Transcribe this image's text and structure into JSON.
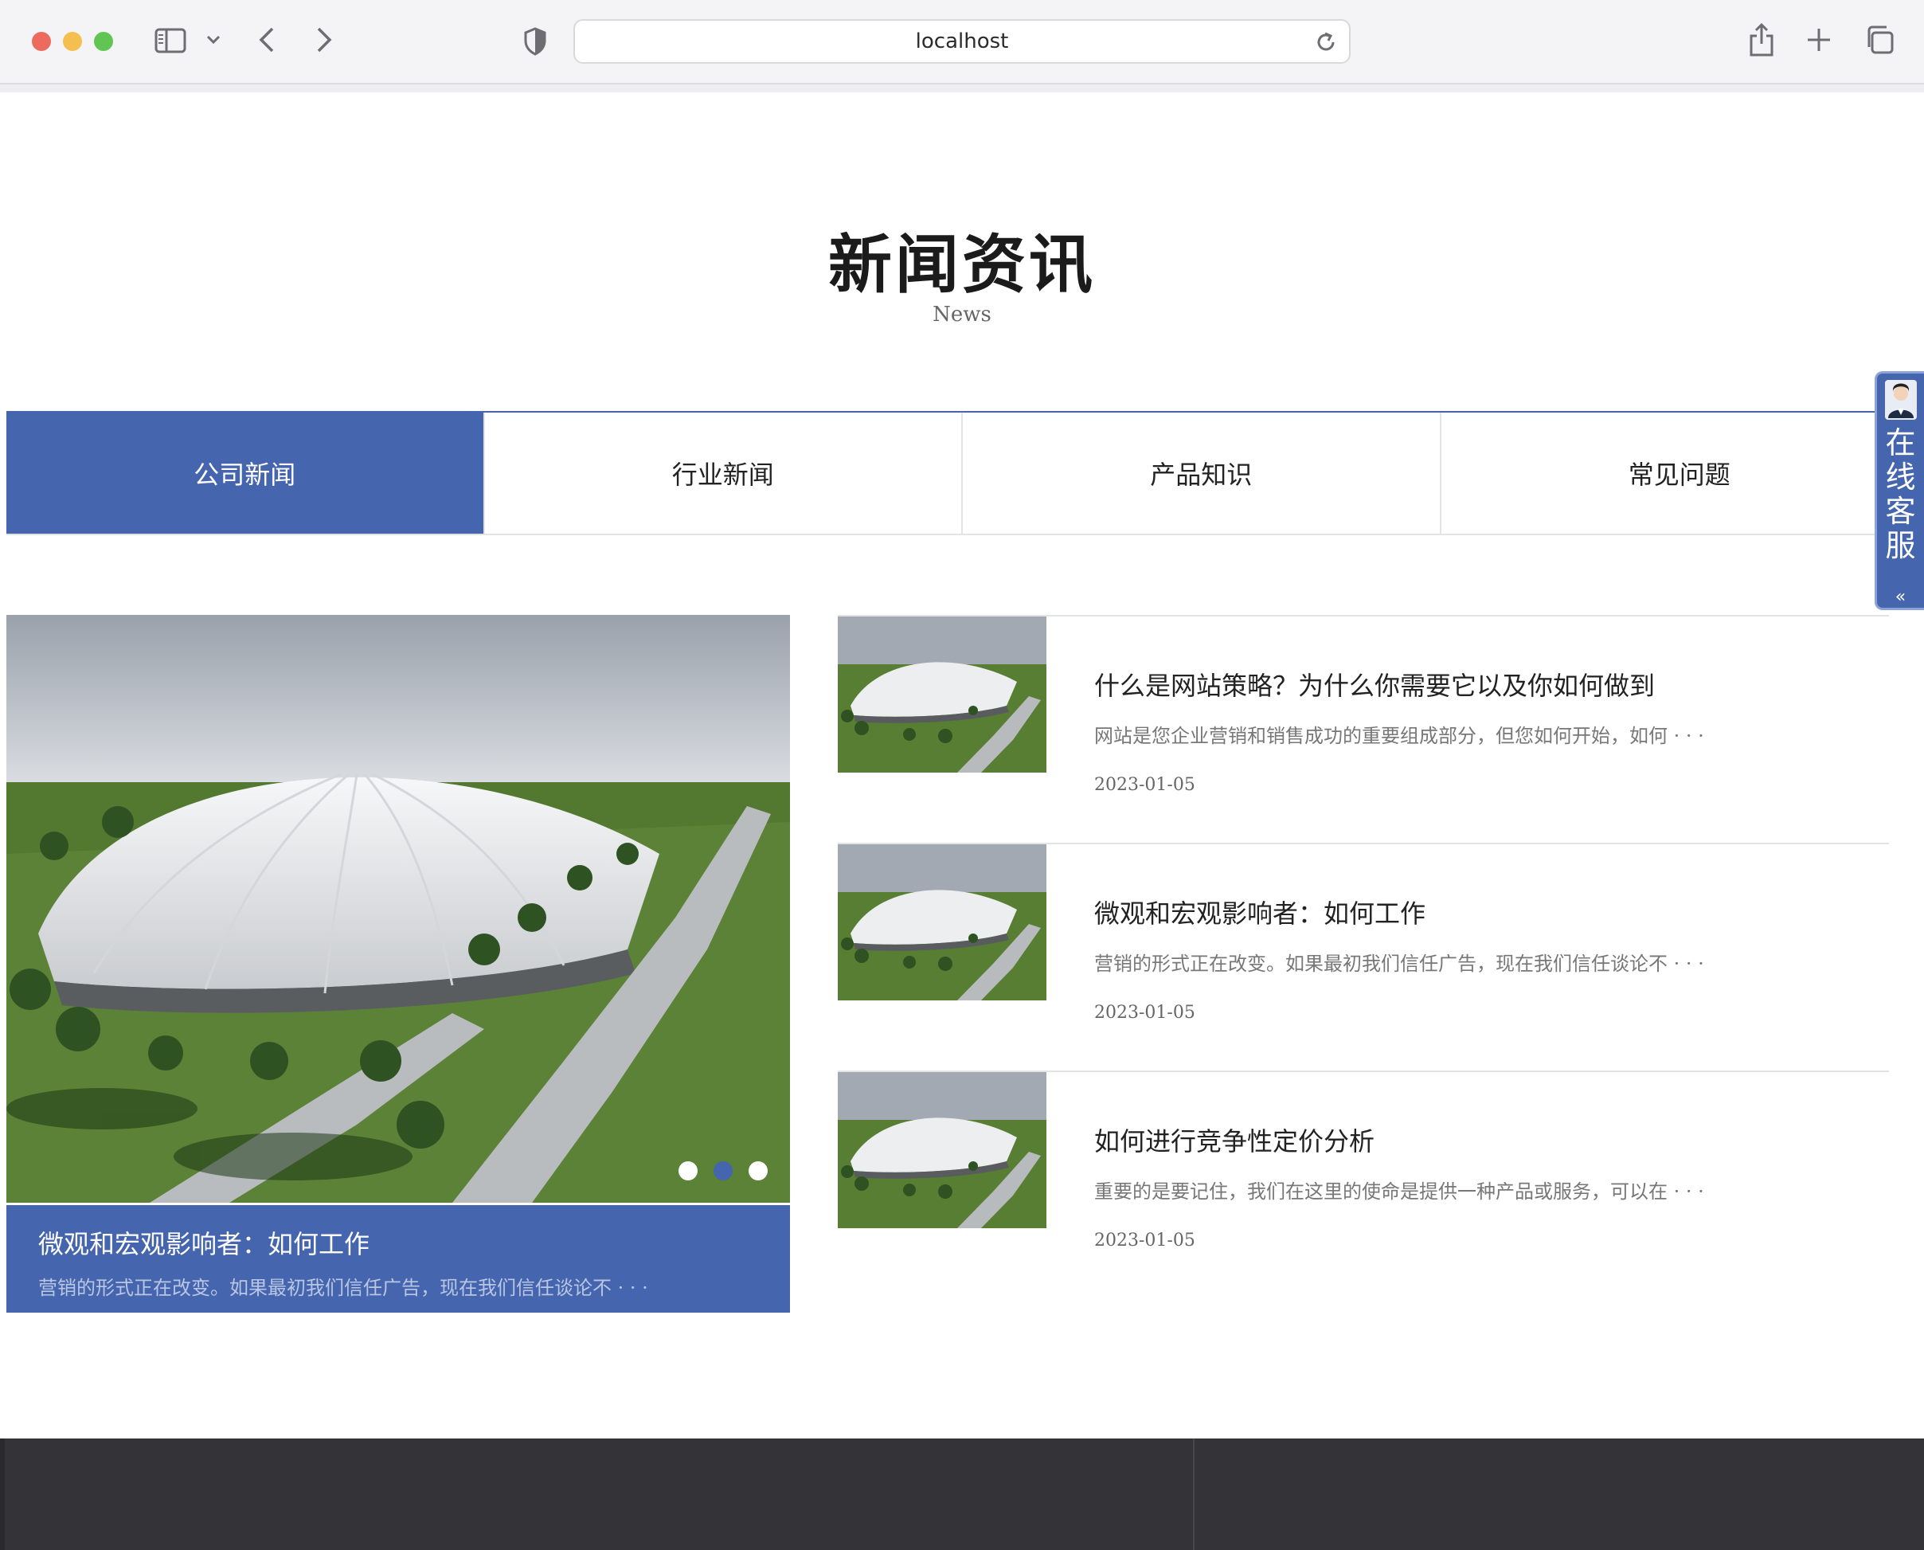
{
  "browser": {
    "url": "localhost"
  },
  "header": {
    "title": "新闻资讯",
    "subtitle": "News"
  },
  "tabs": [
    {
      "label": "公司新闻",
      "active": true
    },
    {
      "label": "行业新闻",
      "active": false
    },
    {
      "label": "产品知识",
      "active": false
    },
    {
      "label": "常见问题",
      "active": false
    }
  ],
  "service": {
    "label_chars": [
      "在",
      "线",
      "客",
      "服"
    ],
    "collapse": "«"
  },
  "feature": {
    "title": "微观和宏观影响者：如何工作",
    "description": "营销的形式正在改变。如果最初我们信任广告，现在我们信任谈论不 · · ·",
    "dots": 3,
    "active_dot": 2
  },
  "news": [
    {
      "title": "什么是网站策略？为什么你需要它以及你如何做到",
      "description": "网站是您企业营销和销售成功的重要组成部分，但您如何开始，如何 · · ·",
      "date": "2023-01-05"
    },
    {
      "title": "微观和宏观影响者：如何工作",
      "description": "营销的形式正在改变。如果最初我们信任广告，现在我们信任谈论不 · · ·",
      "date": "2023-01-05"
    },
    {
      "title": "如何进行竞争性定价分析",
      "description": "重要的是要记住，我们在这里的使命是提供一种产品或服务，可以在 · · ·",
      "date": "2023-01-05"
    }
  ],
  "colors": {
    "brand": "#4565ae",
    "footer": "#343337"
  }
}
